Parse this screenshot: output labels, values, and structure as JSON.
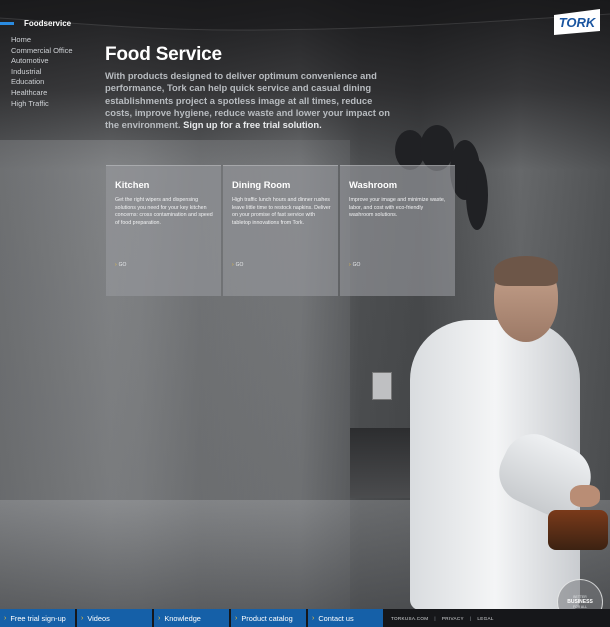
{
  "brand": {
    "logo_text": "TORK"
  },
  "nav": {
    "active": "Foodservice",
    "items": [
      "Home",
      "Commercial Office",
      "Automotive",
      "Industrial",
      "Education",
      "Healthcare",
      "High Traffic"
    ]
  },
  "main": {
    "title": "Food Service",
    "intro": "With products designed to deliver optimum convenience and performance, Tork can help quick service and casual dining establishments project a spotless image at all times, reduce costs, improve hygiene, reduce waste and lower your impact on the environment.",
    "cta": "Sign up for a free trial solution."
  },
  "cards": [
    {
      "title": "Kitchen",
      "text": "Get the right wipers and dispensing solutions you need for your key kitchen concerns: cross contamination and speed of food preparation.",
      "link": "GO"
    },
    {
      "title": "Dining Room",
      "text": "High traffic lunch hours and dinner rushes leave little time to restock napkins. Deliver on your promise of fast service with tabletop innovations from Tork.",
      "link": "GO"
    },
    {
      "title": "Washroom",
      "text": "Improve your image and minimize waste, labor, and cost with eco-friendly washroom solutions.",
      "link": "GO"
    }
  ],
  "footer": {
    "tabs": [
      "Free trial sign-up",
      "Videos",
      "Knowledge",
      "Product catalog",
      "Contact us"
    ],
    "links": [
      "TORKUSA.COM",
      "PRIVACY",
      "LEGAL"
    ]
  },
  "badge": {
    "top": "BETTER",
    "main": "BUSINESS",
    "bottom": "FOR ALL"
  },
  "colors": {
    "accent": "#2a8be0",
    "footer_tab": "#1560a8",
    "arrow": "#f2c23a"
  }
}
